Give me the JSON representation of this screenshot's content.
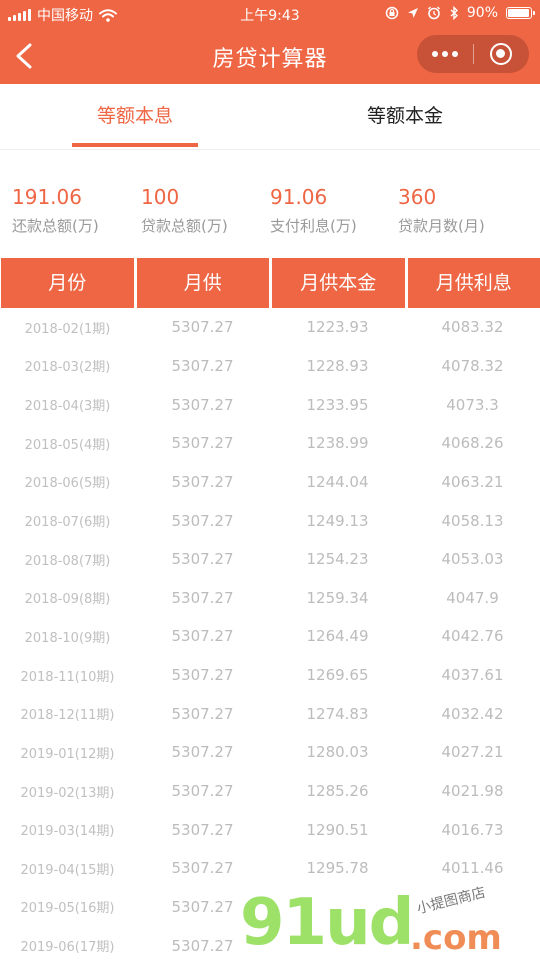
{
  "status_bar": {
    "carrier": "中国移动",
    "time": "上午9:43",
    "battery": "90%"
  },
  "nav": {
    "title": "房贷计算器"
  },
  "tabs": [
    {
      "label": "等额本息",
      "active": true
    },
    {
      "label": "等额本金",
      "active": false
    }
  ],
  "summary": [
    {
      "value": "191.06",
      "label": "还款总额(万)"
    },
    {
      "value": "100",
      "label": "贷款总额(万)"
    },
    {
      "value": "91.06",
      "label": "支付利息(万)"
    },
    {
      "value": "360",
      "label": "贷款月数(月)"
    }
  ],
  "table": {
    "headers": [
      "月份",
      "月供",
      "月供本金",
      "月供利息"
    ],
    "rows": [
      [
        "2018-02(1期)",
        "5307.27",
        "1223.93",
        "4083.32"
      ],
      [
        "2018-03(2期)",
        "5307.27",
        "1228.93",
        "4078.32"
      ],
      [
        "2018-04(3期)",
        "5307.27",
        "1233.95",
        "4073.3"
      ],
      [
        "2018-05(4期)",
        "5307.27",
        "1238.99",
        "4068.26"
      ],
      [
        "2018-06(5期)",
        "5307.27",
        "1244.04",
        "4063.21"
      ],
      [
        "2018-07(6期)",
        "5307.27",
        "1249.13",
        "4058.13"
      ],
      [
        "2018-08(7期)",
        "5307.27",
        "1254.23",
        "4053.03"
      ],
      [
        "2018-09(8期)",
        "5307.27",
        "1259.34",
        "4047.9"
      ],
      [
        "2018-10(9期)",
        "5307.27",
        "1264.49",
        "4042.76"
      ],
      [
        "2018-11(10期)",
        "5307.27",
        "1269.65",
        "4037.61"
      ],
      [
        "2018-12(11期)",
        "5307.27",
        "1274.83",
        "4032.42"
      ],
      [
        "2019-01(12期)",
        "5307.27",
        "1280.03",
        "4027.21"
      ],
      [
        "2019-02(13期)",
        "5307.27",
        "1285.26",
        "4021.98"
      ],
      [
        "2019-03(14期)",
        "5307.27",
        "1290.51",
        "4016.73"
      ],
      [
        "2019-04(15期)",
        "5307.27",
        "1295.78",
        "4011.46"
      ],
      [
        "2019-05(16期)",
        "5307.27",
        "",
        ""
      ],
      [
        "2019-06(17期)",
        "5307.27",
        "",
        ""
      ]
    ]
  },
  "watermark": {
    "main": "91ud",
    "suffix": ".com",
    "note": "小提图商店"
  },
  "colors": {
    "accent": "#ee6644",
    "muted_text": "#9a9a9a",
    "table_text": "#bcbcbc"
  }
}
